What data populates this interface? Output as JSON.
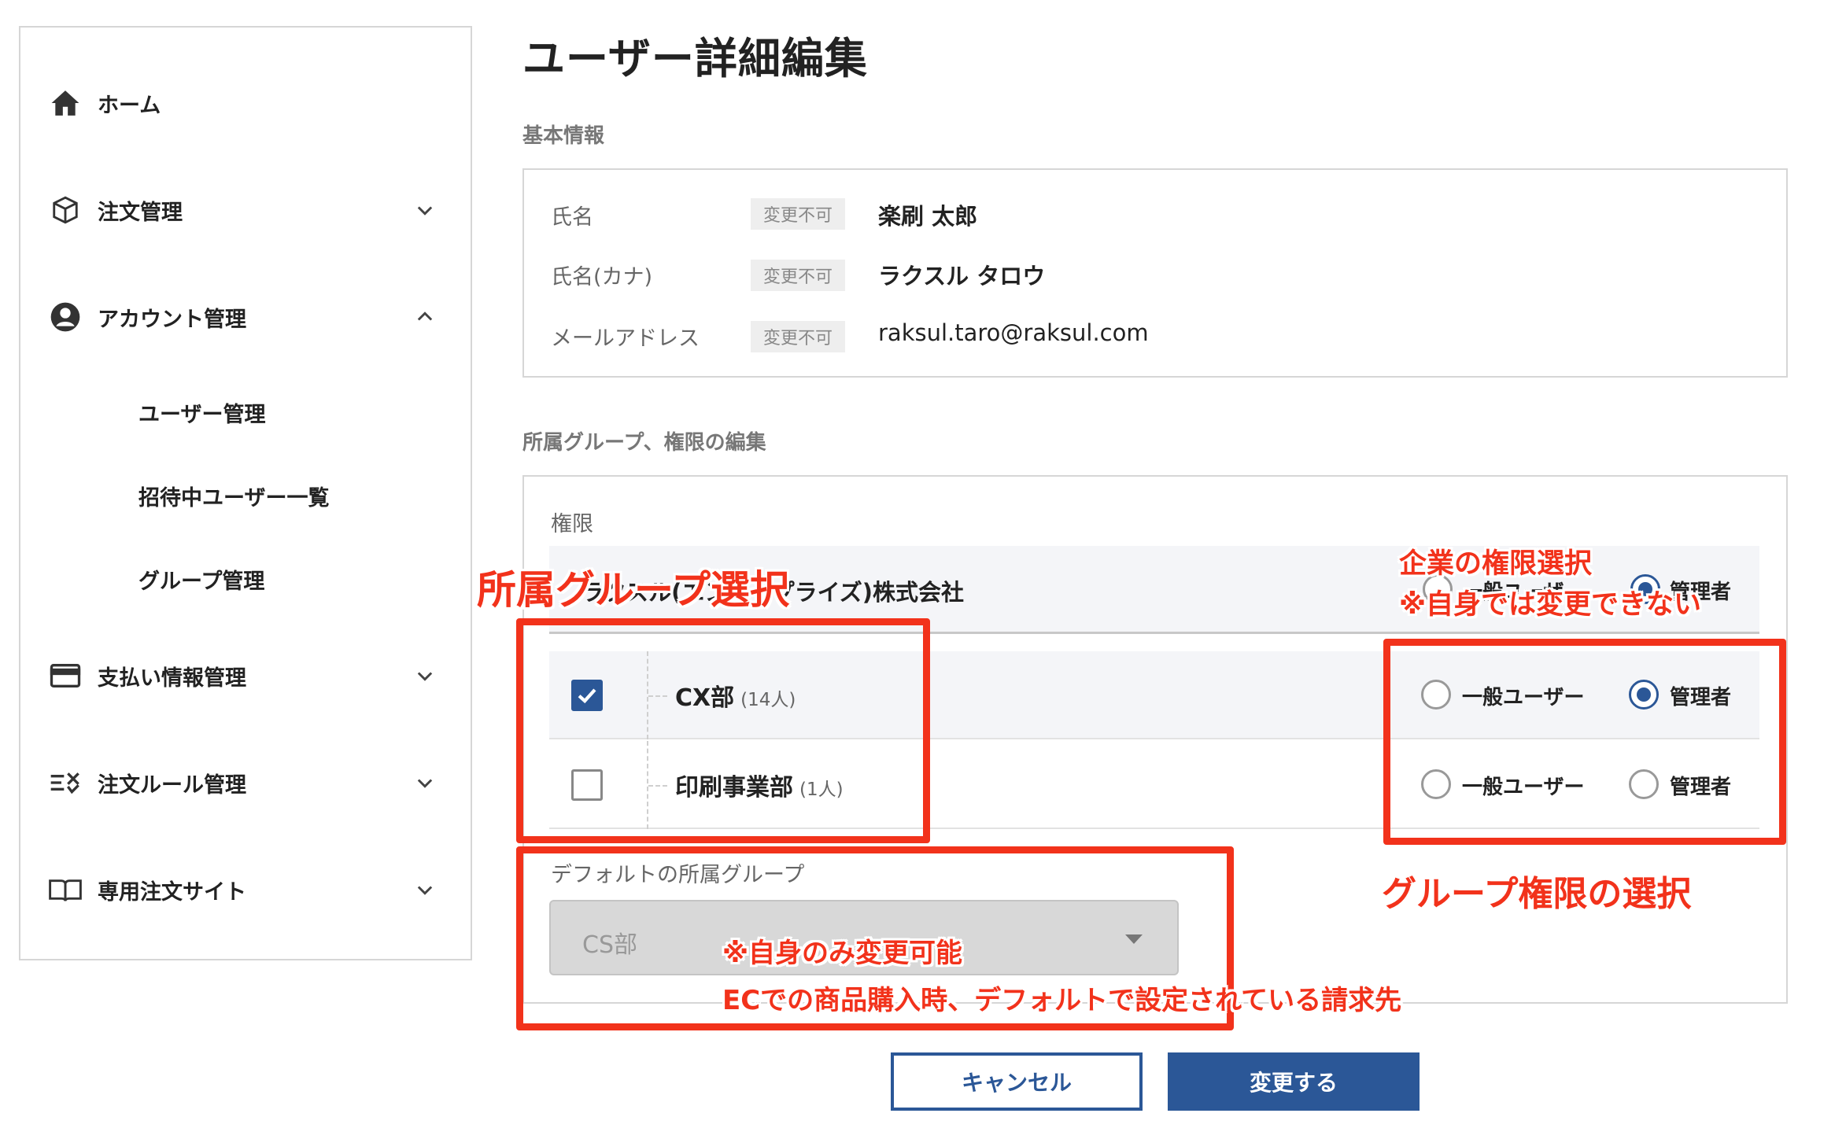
{
  "sidebar": {
    "items": [
      {
        "label": "ホーム",
        "icon": "home-icon"
      },
      {
        "label": "注文管理",
        "icon": "box-icon"
      },
      {
        "label": "アカウント管理",
        "icon": "account-icon"
      },
      {
        "label": "支払い情報管理",
        "icon": "card-icon"
      },
      {
        "label": "注文ルール管理",
        "icon": "rule-icon"
      },
      {
        "label": "専用注文サイト",
        "icon": "book-icon"
      }
    ],
    "sub_items": [
      {
        "label": "ユーザー管理"
      },
      {
        "label": "招待中ユーザー一覧"
      },
      {
        "label": "グループ管理"
      }
    ]
  },
  "page": {
    "title": "ユーザー詳細編集"
  },
  "basic_info": {
    "section_title": "基本情報",
    "rows": [
      {
        "label": "氏名",
        "badge": "変更不可",
        "value": "楽刷 太郎"
      },
      {
        "label": "氏名(カナ)",
        "badge": "変更不可",
        "value": "ラクスル タロウ"
      },
      {
        "label": "メールアドレス",
        "badge": "変更不可",
        "value": "raksul.taro@raksul.com"
      }
    ]
  },
  "group_edit": {
    "section_title": "所属グループ、権限の編集",
    "permission_label": "権限",
    "company": {
      "name": "ラクスル(エンタープライズ)株式会社",
      "options": [
        "一般ユーザー",
        "管理者"
      ],
      "selected": "管理者"
    },
    "groups": [
      {
        "name": "CX部",
        "count": "(14人)",
        "checked": true,
        "options": [
          "一般ユーザー",
          "管理者"
        ],
        "selected": "管理者"
      },
      {
        "name": "印刷事業部",
        "count": "(1人)",
        "checked": false,
        "options": [
          "一般ユーザー",
          "管理者"
        ],
        "selected": ""
      }
    ],
    "default_group_label": "デフォルトの所属グループ",
    "default_group_value": "CS部"
  },
  "buttons": {
    "cancel": "キャンセル",
    "submit": "変更する"
  },
  "annotations": {
    "group_select": "所属グループ選択",
    "company_perm_line1": "企業の権限選択",
    "company_perm_line2": "※自身では変更できない",
    "group_perm": "グループ権限の選択",
    "default_line1": "※自身のみ変更可能",
    "default_line2": "ECでの商品購入時、デフォルトで設定されている請求先"
  },
  "colors": {
    "accent": "#2b5797",
    "annotation": "#f2321b"
  }
}
